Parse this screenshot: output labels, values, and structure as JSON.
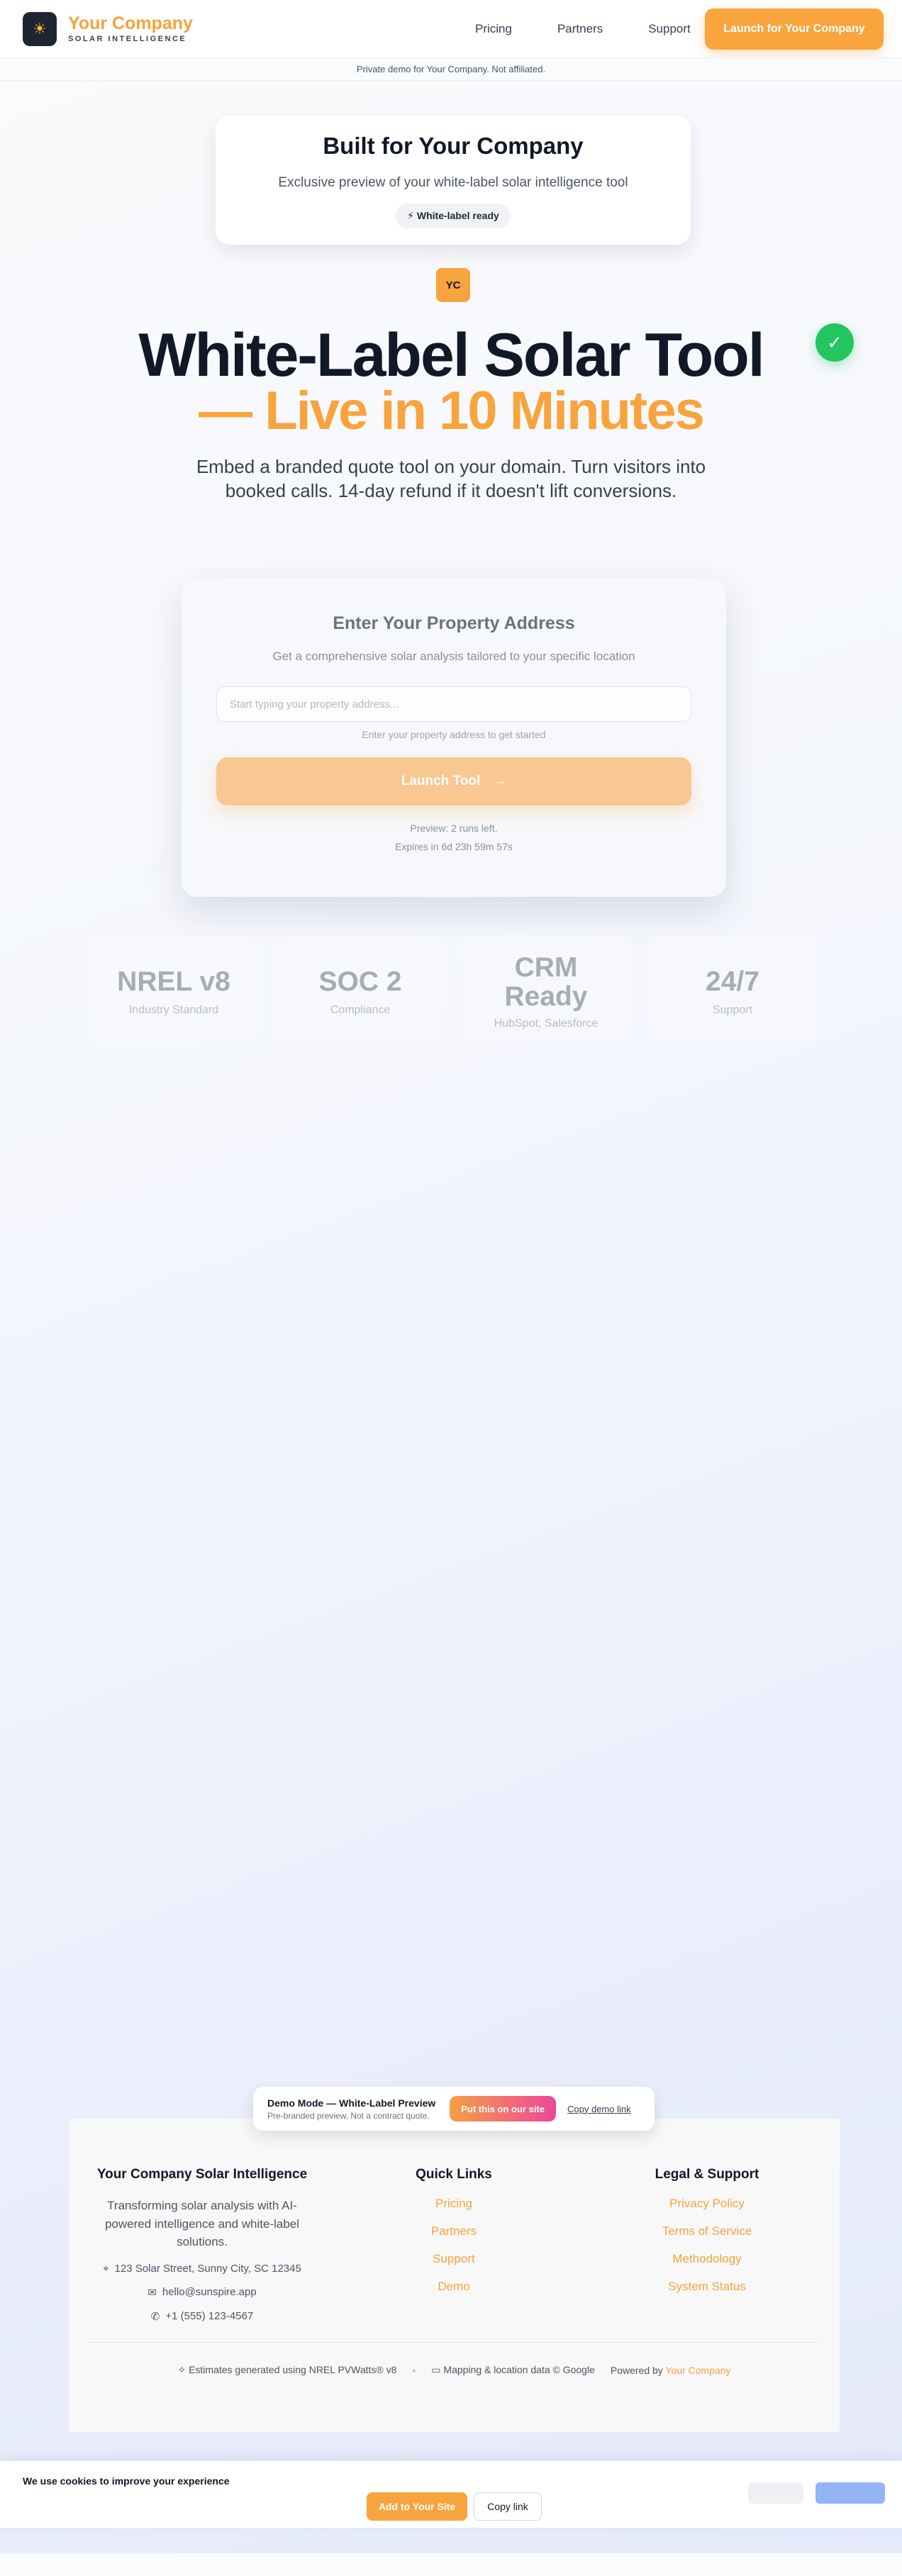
{
  "header": {
    "logo_icon": "sun-icon",
    "brand_name": "Your Company",
    "brand_tag": "SOLAR INTELLIGENCE",
    "nav": [
      "Pricing",
      "Partners",
      "Support"
    ],
    "cta": "Launch for Your Company"
  },
  "notice": "Private demo for Your Company. Not affiliated.",
  "built_card": {
    "title": "Built for Your Company",
    "subtitle": "Exclusive preview of your white-label solar intelligence tool",
    "badge": "⚡ White-label ready"
  },
  "initials": "YC",
  "check_icon": "✓",
  "hero": {
    "line1": "White-Label Solar Tool",
    "line2": "— Live in 10 Minutes",
    "subtitle": "Embed a branded quote tool on your domain. Turn visitors into booked calls. 14-day refund if it doesn't lift conversions."
  },
  "address_card": {
    "title": "Enter Your Property Address",
    "subtitle": "Get a comprehensive solar analysis tailored to your specific location",
    "placeholder": "Start typing your property address...",
    "hint": "Enter your property address to get started",
    "button": "Launch Tool",
    "button_arrow": "→",
    "preview": "Preview: 2 runs left.",
    "expires": "Expires in 6d 23h 59m 57s"
  },
  "stats": [
    {
      "value": "NREL v8",
      "label": "Industry Standard"
    },
    {
      "value": "SOC 2",
      "label": "Compliance"
    },
    {
      "value": "CRM Ready",
      "label": "HubSpot, Salesforce"
    },
    {
      "value": "24/7",
      "label": "Support"
    }
  ],
  "demo_bar": {
    "title": "Demo Mode — White-Label Preview",
    "subtitle": "Pre-branded preview. Not a contract quote.",
    "cta": "Put this on our site",
    "copy": "Copy demo link"
  },
  "footer": {
    "company": {
      "title": "Your Company Solar Intelligence",
      "desc": "Transforming solar analysis with AI-powered intelligence and white-label solutions.",
      "address": "123 Solar Street, Sunny City, SC 12345",
      "email": "hello@sunspire.app",
      "phone": "+1 (555) 123-4567"
    },
    "quick_links": {
      "title": "Quick Links",
      "items": [
        "Pricing",
        "Partners",
        "Support",
        "Demo"
      ]
    },
    "legal": {
      "title": "Legal & Support",
      "items": [
        "Privacy Policy",
        "Terms of Service",
        "Methodology",
        "System Status"
      ]
    },
    "bottom": {
      "nrel": "Estimates generated using NREL PVWatts® v8",
      "maps": "Mapping & location data © Google",
      "powered_prefix": "Powered by",
      "powered_brand": "Your Company"
    }
  },
  "cookie": {
    "text": "We use cookies to improve your experience",
    "add": "Add to Your Site",
    "copy": "Copy link"
  }
}
